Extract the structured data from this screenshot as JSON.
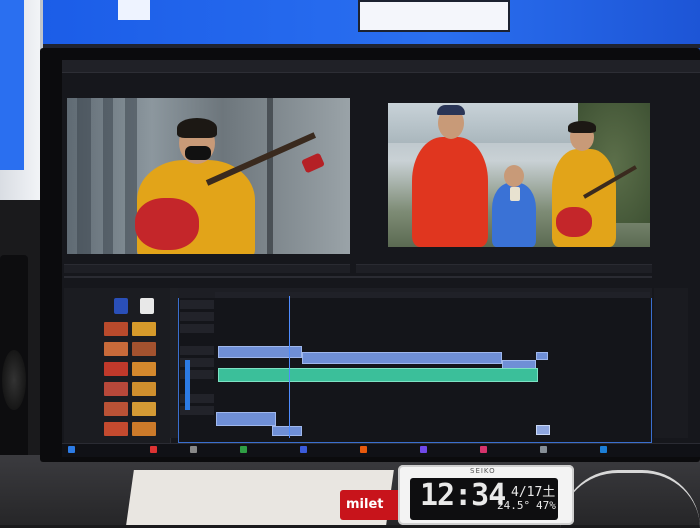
{
  "clock": {
    "brand": "SEIKO",
    "time": "12:34",
    "date": "4/17土",
    "temperature": "24.5°",
    "humidity": "47%"
  },
  "desk": {
    "red_box_label": "milet"
  },
  "editor": {
    "source_monitor": "source frame: guitarist in yellow jumpsuit",
    "program_monitor": "program frame: three performers",
    "colors": {
      "accent": "#2c7be5",
      "video_clip": "#6f8fd6",
      "audio_clip": "#3bbf9a",
      "panel": "#1b1c21",
      "background": "#16171c"
    }
  }
}
